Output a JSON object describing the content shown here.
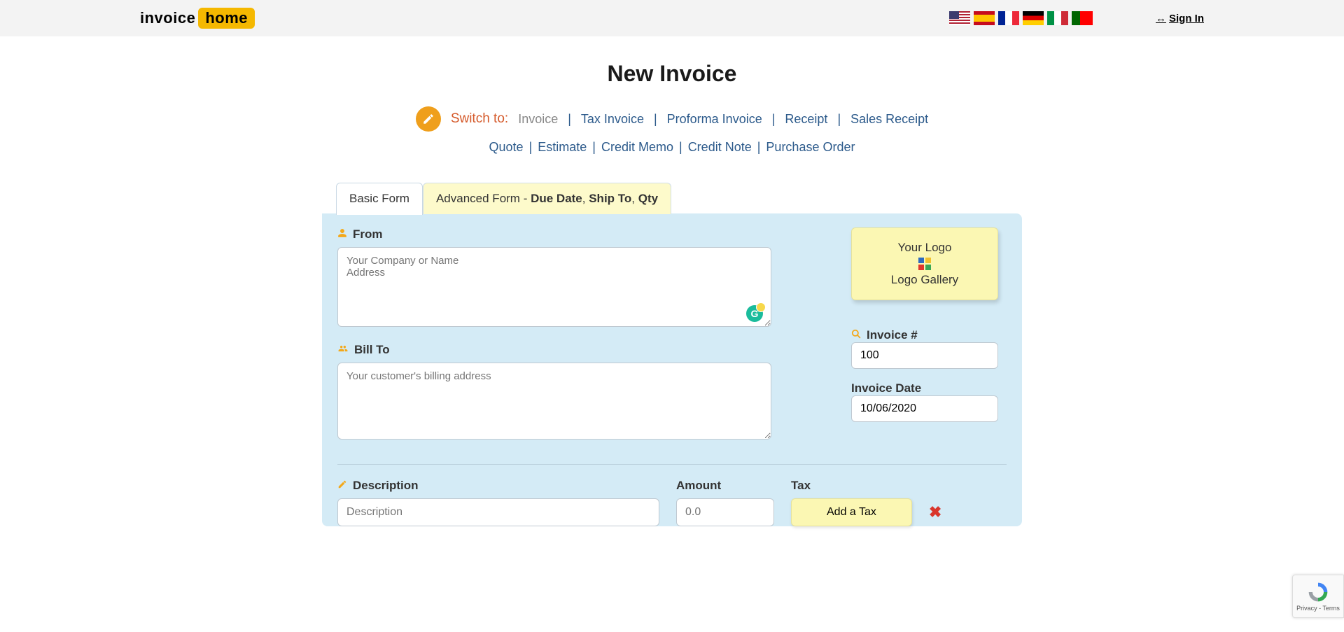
{
  "header": {
    "logo_invoice": "invoice",
    "logo_home": "home",
    "signin_label": "Sign In",
    "flags": [
      "us",
      "es",
      "fr",
      "de",
      "it",
      "pt"
    ]
  },
  "page": {
    "title": "New Invoice",
    "switch_label": "Switch to:",
    "doc_types_row1": [
      {
        "label": "Invoice",
        "current": true
      },
      {
        "label": "Tax Invoice"
      },
      {
        "label": "Proforma Invoice"
      },
      {
        "label": "Receipt"
      },
      {
        "label": "Sales Receipt"
      }
    ],
    "doc_types_row2": [
      {
        "label": "Quote"
      },
      {
        "label": "Estimate"
      },
      {
        "label": "Credit Memo"
      },
      {
        "label": "Credit Note"
      },
      {
        "label": "Purchase Order"
      }
    ]
  },
  "tabs": {
    "basic": "Basic Form",
    "advanced_prefix": "Advanced Form - ",
    "advanced_parts": [
      "Due Date",
      ", ",
      "Ship To",
      ", ",
      "Qty"
    ]
  },
  "form": {
    "from_label": "From",
    "from_placeholder": "Your Company or Name\nAddress",
    "billto_label": "Bill To",
    "billto_placeholder": "Your customer's billing address",
    "logo_box_line1": "Your Logo",
    "logo_box_line2": "Logo Gallery",
    "invoice_num_label": "Invoice #",
    "invoice_num_value": "100",
    "invoice_date_label": "Invoice Date",
    "invoice_date_value": "10/06/2020"
  },
  "items": {
    "desc_label": "Description",
    "amount_label": "Amount",
    "tax_label": "Tax",
    "desc_placeholder": "Description",
    "amount_placeholder": "0.0",
    "add_tax_label": "Add a Tax",
    "remove_icon": "✖"
  },
  "recaptcha": {
    "privacy": "Privacy",
    "terms": "Terms"
  }
}
